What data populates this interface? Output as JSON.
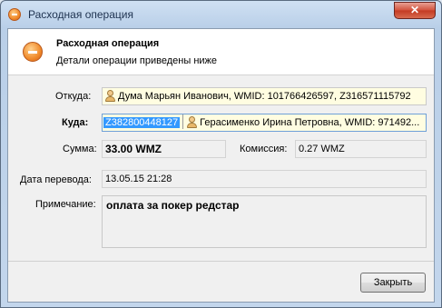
{
  "window": {
    "title": "Расходная операция",
    "close_glyph": "✕"
  },
  "header": {
    "title": "Расходная операция",
    "subtitle": "Детали операции приведены ниже"
  },
  "from": {
    "label": "Откуда:",
    "value": "Дума Марьян Иванович, WMID: 101766426597, Z316571115792"
  },
  "to": {
    "label": "Куда:",
    "purse": "Z382800448127",
    "value": "Герасименко Ирина Петровна, WMID: 971492..."
  },
  "amount": {
    "label": "Сумма:",
    "value": "33.00 WMZ"
  },
  "commission": {
    "label": "Комиссия:",
    "value": "0.27 WMZ"
  },
  "date": {
    "label": "Дата перевода:",
    "value": "13.05.15 21:28"
  },
  "note": {
    "label": "Примечание:",
    "value": "оплата за покер редстар"
  },
  "buttons": {
    "close_label": "Закрыть"
  }
}
